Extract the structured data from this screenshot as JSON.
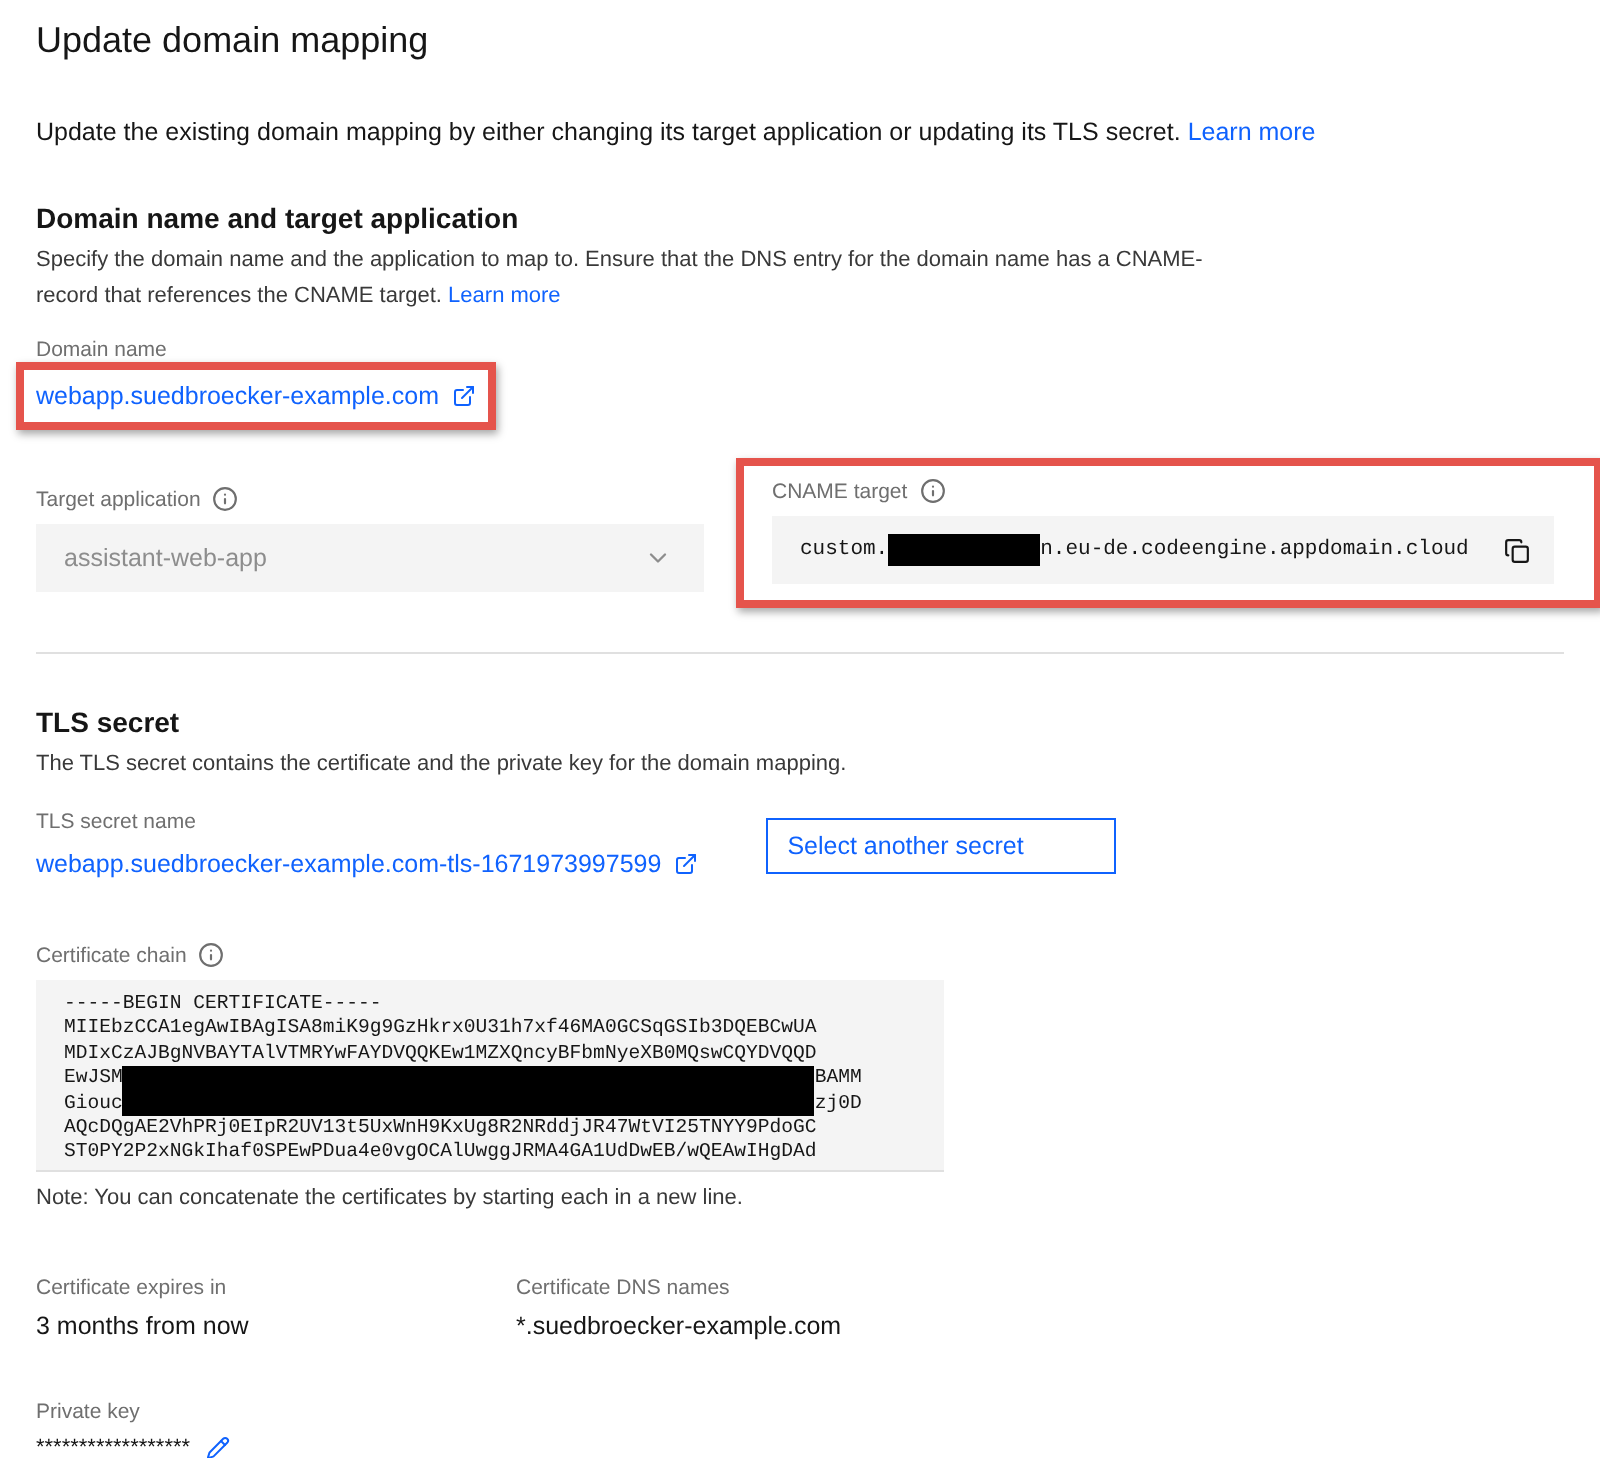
{
  "title": "Update domain mapping",
  "intro": {
    "text": "Update the existing domain mapping by either changing its target application or updating its TLS secret.",
    "link": "Learn more"
  },
  "domain_section": {
    "heading": "Domain name and target application",
    "description": "Specify the domain name and the application to map to. Ensure that the DNS entry for the domain name has a CNAME-record that references the CNAME target.",
    "link": "Learn more",
    "domain_name": {
      "label": "Domain name",
      "value": "webapp.suedbroecker-example.com",
      "highlighted": true
    },
    "target_application": {
      "label": "Target application",
      "value": "assistant-web-app",
      "disabled": true
    },
    "cname_target": {
      "label": "CNAME target",
      "prefix": "custom.",
      "suffix": "n.eu-de.codeengine.appdomain.cloud",
      "redacted": true,
      "highlighted": true
    }
  },
  "tls_section": {
    "heading": "TLS secret",
    "description": "The TLS secret contains the certificate and the private key for the domain mapping.",
    "secret_name": {
      "label": "TLS secret name",
      "value": "webapp.suedbroecker-example.com-tls-1671973997599"
    },
    "select_button": "Select another secret",
    "certificate_chain": {
      "label": "Certificate chain",
      "lines": [
        {
          "start": "-----BEGIN CERTIFICATE-----"
        },
        {
          "start": "MIIEbzCCA1egAwIBAgISA8miK9g9GzHkrx0U31h7xf46MA0GCSqGSIb3DQEBCwUA"
        },
        {
          "start": "MDIxCzAJBgNVBAYTAlVTMRYwFAYDVQQKEw1MZXQncyBFbmNyeXB0MQswCQYDVQQD"
        },
        {
          "start": "EwJSM",
          "end": "BAMM",
          "redacted": true
        },
        {
          "start": "Giouc",
          "end": "zj0D",
          "redacted": true
        },
        {
          "start": "AQcDQgAE2VhPRj0EIpR2UV13t5UxWnH9KxUg8R2NRddjJR47WtVI25TNYY9PdoGC"
        },
        {
          "start": "ST0PY2P2xNGkIhaf0SPEwPDua4e0vgOCAlUwggJRMA4GA1UdDwEB/wQEAwIHgDAd"
        }
      ],
      "note": "Note: You can concatenate the certificates by starting each in a new line."
    },
    "expires": {
      "label": "Certificate expires in",
      "value": "3 months from now"
    },
    "dns_names": {
      "label": "Certificate DNS names",
      "value": "*.suedbroecker-example.com"
    },
    "private_key": {
      "label": "Private key",
      "value": "******************"
    }
  }
}
